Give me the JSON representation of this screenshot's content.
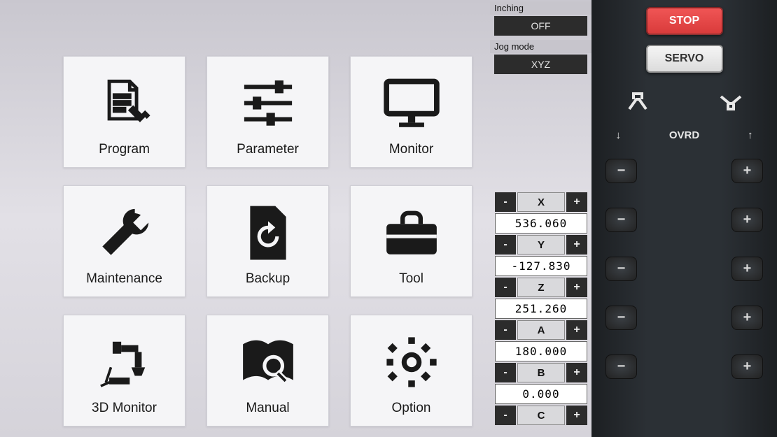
{
  "menu": [
    {
      "id": "program",
      "label": "Program"
    },
    {
      "id": "parameter",
      "label": "Parameter"
    },
    {
      "id": "monitor",
      "label": "Monitor"
    },
    {
      "id": "maintenance",
      "label": "Maintenance"
    },
    {
      "id": "backup",
      "label": "Backup"
    },
    {
      "id": "tool",
      "label": "Tool"
    },
    {
      "id": "3d-monitor",
      "label": "3D Monitor"
    },
    {
      "id": "manual",
      "label": "Manual"
    },
    {
      "id": "option",
      "label": "Option"
    }
  ],
  "status": {
    "inching_label": "Inching",
    "inching_value": "OFF",
    "jogmode_label": "Jog mode",
    "jogmode_value": "XYZ"
  },
  "axes": [
    {
      "name": "X",
      "value": "536.060"
    },
    {
      "name": "Y",
      "value": "-127.830"
    },
    {
      "name": "Z",
      "value": "251.260"
    },
    {
      "name": "A",
      "value": "180.000"
    },
    {
      "name": "B",
      "value": "0.000"
    },
    {
      "name": "C",
      "value": ""
    }
  ],
  "axis_btn": {
    "minus": "-",
    "plus": "+"
  },
  "hardware": {
    "stop": "STOP",
    "servo": "SERVO",
    "ovrd": "OVRD",
    "down": "↓",
    "up": "↑",
    "minus": "−",
    "plus": "+"
  }
}
